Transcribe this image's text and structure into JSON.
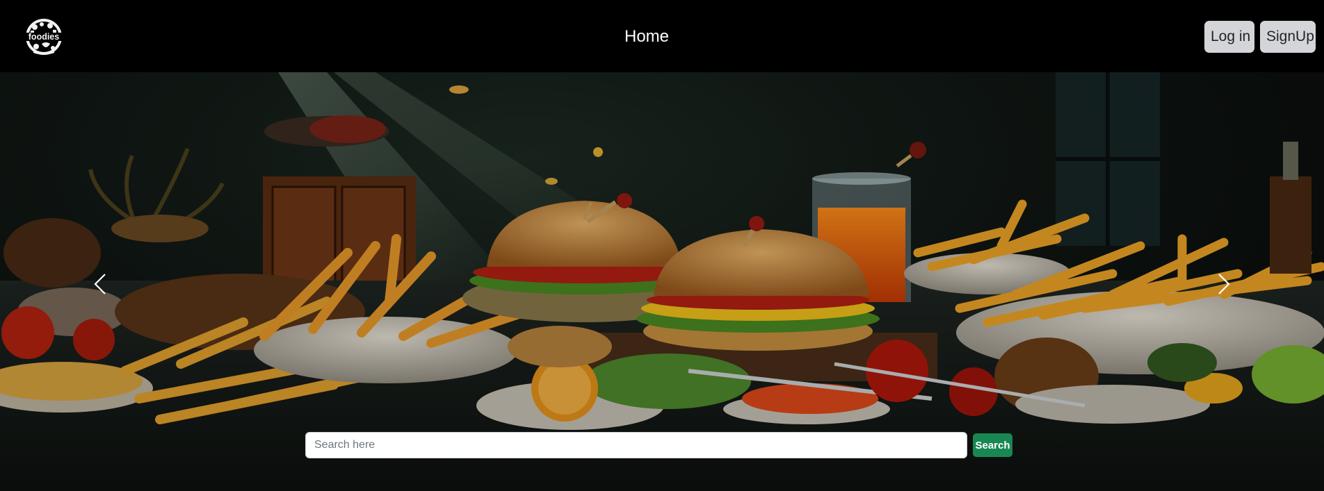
{
  "navbar": {
    "logo_text": "foodies",
    "home_label": "Home",
    "login_label": "Log in",
    "signup_label": "SignUp"
  },
  "hero": {
    "image_icon": "food-spread-image",
    "prev_icon": "chevron-left-icon",
    "next_icon": "chevron-right-icon"
  },
  "search": {
    "placeholder": "Search here",
    "value": "",
    "button_label": "Search"
  },
  "colors": {
    "navbar_bg": "#000000",
    "nav_button_bg": "#d4d5d8",
    "search_button_bg": "#198754",
    "text_light": "#ffffff"
  }
}
